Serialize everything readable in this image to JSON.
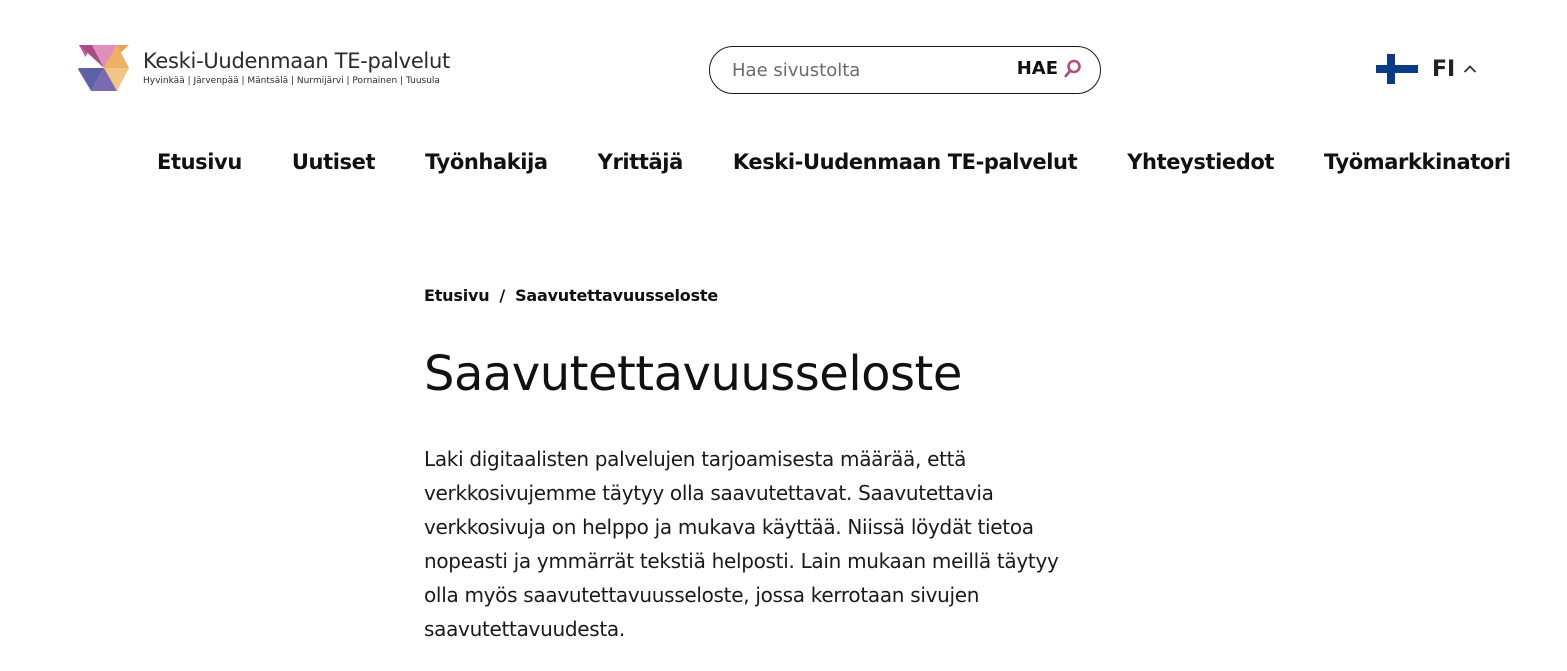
{
  "header": {
    "logo": {
      "title": "Keski-Uudenmaan TE-palvelut",
      "subtitle": "Hyvinkää | Järvenpää | Mäntsälä | Nurmijärvi | Pornainen | Tuusula",
      "colors": [
        "#b44a8a",
        "#e9a24f",
        "#5f5fa5",
        "#d17fb0",
        "#f2c485"
      ]
    },
    "search": {
      "placeholder": "Hae sivustolta",
      "value": "",
      "button_label": "HAE",
      "icon": "search-icon",
      "icon_color": "#b04e82"
    },
    "language": {
      "code": "FI",
      "flag": "finland-flag-icon",
      "flag_colors": [
        "#ffffff",
        "#0a3a86"
      ]
    }
  },
  "nav": {
    "items": [
      {
        "label": "Etusivu"
      },
      {
        "label": "Uutiset"
      },
      {
        "label": "Työnhakija"
      },
      {
        "label": "Yrittäjä"
      },
      {
        "label": "Keski-Uudenmaan TE-palvelut"
      },
      {
        "label": "Yhteystiedot"
      },
      {
        "label": "Työmarkkinatori"
      }
    ]
  },
  "breadcrumb": {
    "home": "Etusivu",
    "separator": "/",
    "current": "Saavutettavuusseloste"
  },
  "main": {
    "title": "Saavutettavuusseloste",
    "lead": "Laki digitaalisten palvelujen tarjoamisesta määrää, että verkkosivujemme täytyy olla saavutettavat. Saavutettavia verkkosivuja on helppo ja mukava käyttää. Niissä löydät tietoa nopeasti ja ymmärrät tekstiä helposti. Lain mukaan meillä täytyy olla myös saavutettavuusseloste, jossa kerrotaan sivujen saavutettavuudesta."
  }
}
